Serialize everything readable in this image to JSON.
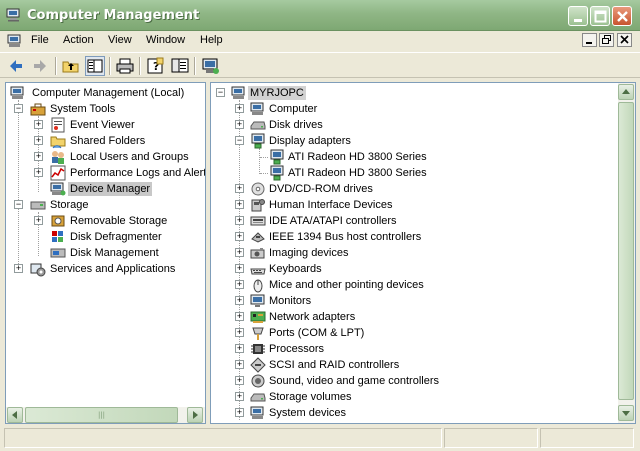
{
  "window": {
    "title": "Computer Management"
  },
  "menu": {
    "items": [
      "File",
      "Action",
      "View",
      "Window",
      "Help"
    ]
  },
  "toolbar": {
    "buttons": [
      "back-icon",
      "forward-icon",
      "up-folder-icon",
      "show-hide-console-tree-icon",
      "print-icon",
      "help-icon",
      "properties-icon",
      "device-manager-icon"
    ]
  },
  "left_tree": {
    "items": [
      {
        "label": "Computer Management (Local)",
        "icon": "computer-management-icon"
      },
      {
        "label": "System Tools",
        "icon": "toolbox-icon"
      },
      {
        "label": "Event Viewer",
        "icon": "event-viewer-icon"
      },
      {
        "label": "Shared Folders",
        "icon": "shared-folder-icon"
      },
      {
        "label": "Local Users and Groups",
        "icon": "users-icon"
      },
      {
        "label": "Performance Logs and Alerts",
        "icon": "performance-icon"
      },
      {
        "label": "Device Manager",
        "icon": "device-manager-icon"
      },
      {
        "label": "Storage",
        "icon": "storage-icon"
      },
      {
        "label": "Removable Storage",
        "icon": "removable-storage-icon"
      },
      {
        "label": "Disk Defragmenter",
        "icon": "defrag-icon"
      },
      {
        "label": "Disk Management",
        "icon": "disk-management-icon"
      },
      {
        "label": "Services and Applications",
        "icon": "services-icon"
      }
    ]
  },
  "right_tree": {
    "root": "MYRJOPC",
    "items": [
      {
        "label": "Computer",
        "icon": "computer-icon"
      },
      {
        "label": "Disk drives",
        "icon": "disk-drive-icon"
      },
      {
        "label": "Display adapters",
        "icon": "display-adapter-icon"
      },
      {
        "label": "ATI Radeon HD 3800 Series",
        "icon": "display-adapter-icon"
      },
      {
        "label": "ATI Radeon HD 3800 Series",
        "icon": "display-adapter-icon"
      },
      {
        "label": "DVD/CD-ROM drives",
        "icon": "dvd-icon"
      },
      {
        "label": "Human Interface Devices",
        "icon": "hid-icon"
      },
      {
        "label": "IDE ATA/ATAPI controllers",
        "icon": "ide-icon"
      },
      {
        "label": "IEEE 1394 Bus host controllers",
        "icon": "ieee1394-icon"
      },
      {
        "label": "Imaging devices",
        "icon": "camera-icon"
      },
      {
        "label": "Keyboards",
        "icon": "keyboard-icon"
      },
      {
        "label": "Mice and other pointing devices",
        "icon": "mouse-icon"
      },
      {
        "label": "Monitors",
        "icon": "monitor-icon"
      },
      {
        "label": "Network adapters",
        "icon": "network-icon"
      },
      {
        "label": "Ports (COM & LPT)",
        "icon": "port-icon"
      },
      {
        "label": "Processors",
        "icon": "processor-icon"
      },
      {
        "label": "SCSI and RAID controllers",
        "icon": "scsi-icon"
      },
      {
        "label": "Sound, video and game controllers",
        "icon": "sound-icon"
      },
      {
        "label": "Storage volumes",
        "icon": "storage-volume-icon"
      },
      {
        "label": "System devices",
        "icon": "system-devices-icon"
      }
    ]
  },
  "scrollbars": {
    "left_horizontal_grip": "|||"
  },
  "colors": {
    "titlebar": "#8fb685",
    "selection": "#c8c8c8",
    "pane_border": "#7f9db9"
  }
}
